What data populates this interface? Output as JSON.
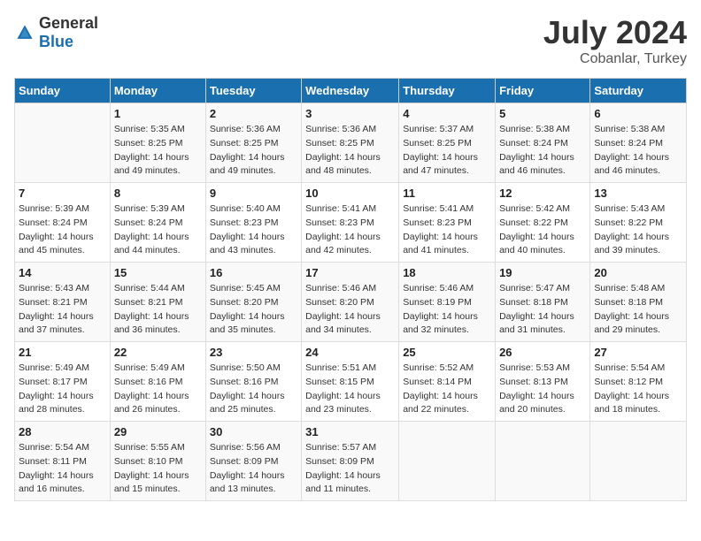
{
  "logo": {
    "text_general": "General",
    "text_blue": "Blue"
  },
  "title": "July 2024",
  "subtitle": "Cobanlar, Turkey",
  "days_header": [
    "Sunday",
    "Monday",
    "Tuesday",
    "Wednesday",
    "Thursday",
    "Friday",
    "Saturday"
  ],
  "weeks": [
    [
      {
        "day": "",
        "info": ""
      },
      {
        "day": "1",
        "info": "Sunrise: 5:35 AM\nSunset: 8:25 PM\nDaylight: 14 hours\nand 49 minutes."
      },
      {
        "day": "2",
        "info": "Sunrise: 5:36 AM\nSunset: 8:25 PM\nDaylight: 14 hours\nand 49 minutes."
      },
      {
        "day": "3",
        "info": "Sunrise: 5:36 AM\nSunset: 8:25 PM\nDaylight: 14 hours\nand 48 minutes."
      },
      {
        "day": "4",
        "info": "Sunrise: 5:37 AM\nSunset: 8:25 PM\nDaylight: 14 hours\nand 47 minutes."
      },
      {
        "day": "5",
        "info": "Sunrise: 5:38 AM\nSunset: 8:24 PM\nDaylight: 14 hours\nand 46 minutes."
      },
      {
        "day": "6",
        "info": "Sunrise: 5:38 AM\nSunset: 8:24 PM\nDaylight: 14 hours\nand 46 minutes."
      }
    ],
    [
      {
        "day": "7",
        "info": "Sunrise: 5:39 AM\nSunset: 8:24 PM\nDaylight: 14 hours\nand 45 minutes."
      },
      {
        "day": "8",
        "info": "Sunrise: 5:39 AM\nSunset: 8:24 PM\nDaylight: 14 hours\nand 44 minutes."
      },
      {
        "day": "9",
        "info": "Sunrise: 5:40 AM\nSunset: 8:23 PM\nDaylight: 14 hours\nand 43 minutes."
      },
      {
        "day": "10",
        "info": "Sunrise: 5:41 AM\nSunset: 8:23 PM\nDaylight: 14 hours\nand 42 minutes."
      },
      {
        "day": "11",
        "info": "Sunrise: 5:41 AM\nSunset: 8:23 PM\nDaylight: 14 hours\nand 41 minutes."
      },
      {
        "day": "12",
        "info": "Sunrise: 5:42 AM\nSunset: 8:22 PM\nDaylight: 14 hours\nand 40 minutes."
      },
      {
        "day": "13",
        "info": "Sunrise: 5:43 AM\nSunset: 8:22 PM\nDaylight: 14 hours\nand 39 minutes."
      }
    ],
    [
      {
        "day": "14",
        "info": "Sunrise: 5:43 AM\nSunset: 8:21 PM\nDaylight: 14 hours\nand 37 minutes."
      },
      {
        "day": "15",
        "info": "Sunrise: 5:44 AM\nSunset: 8:21 PM\nDaylight: 14 hours\nand 36 minutes."
      },
      {
        "day": "16",
        "info": "Sunrise: 5:45 AM\nSunset: 8:20 PM\nDaylight: 14 hours\nand 35 minutes."
      },
      {
        "day": "17",
        "info": "Sunrise: 5:46 AM\nSunset: 8:20 PM\nDaylight: 14 hours\nand 34 minutes."
      },
      {
        "day": "18",
        "info": "Sunrise: 5:46 AM\nSunset: 8:19 PM\nDaylight: 14 hours\nand 32 minutes."
      },
      {
        "day": "19",
        "info": "Sunrise: 5:47 AM\nSunset: 8:18 PM\nDaylight: 14 hours\nand 31 minutes."
      },
      {
        "day": "20",
        "info": "Sunrise: 5:48 AM\nSunset: 8:18 PM\nDaylight: 14 hours\nand 29 minutes."
      }
    ],
    [
      {
        "day": "21",
        "info": "Sunrise: 5:49 AM\nSunset: 8:17 PM\nDaylight: 14 hours\nand 28 minutes."
      },
      {
        "day": "22",
        "info": "Sunrise: 5:49 AM\nSunset: 8:16 PM\nDaylight: 14 hours\nand 26 minutes."
      },
      {
        "day": "23",
        "info": "Sunrise: 5:50 AM\nSunset: 8:16 PM\nDaylight: 14 hours\nand 25 minutes."
      },
      {
        "day": "24",
        "info": "Sunrise: 5:51 AM\nSunset: 8:15 PM\nDaylight: 14 hours\nand 23 minutes."
      },
      {
        "day": "25",
        "info": "Sunrise: 5:52 AM\nSunset: 8:14 PM\nDaylight: 14 hours\nand 22 minutes."
      },
      {
        "day": "26",
        "info": "Sunrise: 5:53 AM\nSunset: 8:13 PM\nDaylight: 14 hours\nand 20 minutes."
      },
      {
        "day": "27",
        "info": "Sunrise: 5:54 AM\nSunset: 8:12 PM\nDaylight: 14 hours\nand 18 minutes."
      }
    ],
    [
      {
        "day": "28",
        "info": "Sunrise: 5:54 AM\nSunset: 8:11 PM\nDaylight: 14 hours\nand 16 minutes."
      },
      {
        "day": "29",
        "info": "Sunrise: 5:55 AM\nSunset: 8:10 PM\nDaylight: 14 hours\nand 15 minutes."
      },
      {
        "day": "30",
        "info": "Sunrise: 5:56 AM\nSunset: 8:09 PM\nDaylight: 14 hours\nand 13 minutes."
      },
      {
        "day": "31",
        "info": "Sunrise: 5:57 AM\nSunset: 8:09 PM\nDaylight: 14 hours\nand 11 minutes."
      },
      {
        "day": "",
        "info": ""
      },
      {
        "day": "",
        "info": ""
      },
      {
        "day": "",
        "info": ""
      }
    ]
  ]
}
